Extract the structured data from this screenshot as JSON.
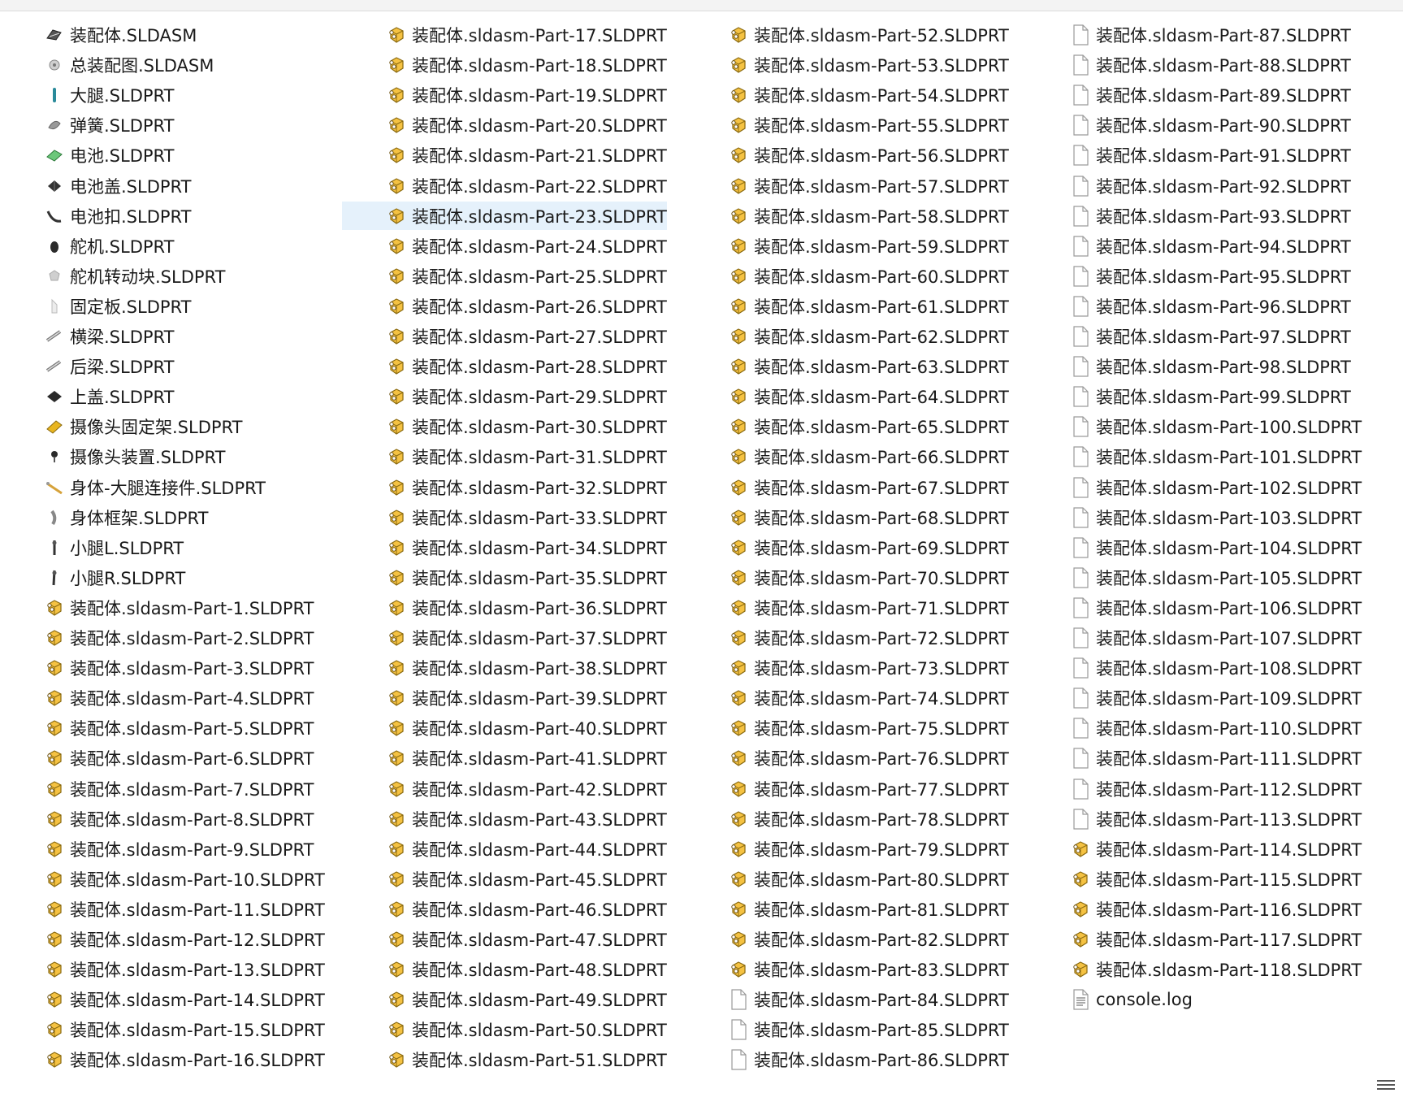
{
  "colors": {
    "selection": "#e5f1fb",
    "part_icon": "#f5c242",
    "blank_icon_border": "#9a9a9a"
  },
  "icons": {
    "part": "solidworks-part-icon",
    "blank": "blank-file-icon",
    "log": "text-file-icon",
    "model": "model-thumbnail-icon"
  },
  "selected_file": "装配体.sldasm-Part-23.SLDPRT",
  "columns": [
    {
      "items": [
        {
          "name": "装配体.SLDASM",
          "icon": "model"
        },
        {
          "name": "总装配图.SLDASM",
          "icon": "model"
        },
        {
          "name": "大腿.SLDPRT",
          "icon": "model"
        },
        {
          "name": "弹簧.SLDPRT",
          "icon": "model"
        },
        {
          "name": "电池.SLDPRT",
          "icon": "model"
        },
        {
          "name": "电池盖.SLDPRT",
          "icon": "model"
        },
        {
          "name": "电池扣.SLDPRT",
          "icon": "model"
        },
        {
          "name": "舵机.SLDPRT",
          "icon": "model"
        },
        {
          "name": "舵机转动块.SLDPRT",
          "icon": "model"
        },
        {
          "name": "固定板.SLDPRT",
          "icon": "model"
        },
        {
          "name": "横梁.SLDPRT",
          "icon": "model"
        },
        {
          "name": "后梁.SLDPRT",
          "icon": "model"
        },
        {
          "name": "上盖.SLDPRT",
          "icon": "model"
        },
        {
          "name": "摄像头固定架.SLDPRT",
          "icon": "model"
        },
        {
          "name": "摄像头装置.SLDPRT",
          "icon": "model"
        },
        {
          "name": "身体-大腿连接件.SLDPRT",
          "icon": "model"
        },
        {
          "name": "身体框架.SLDPRT",
          "icon": "model"
        },
        {
          "name": "小腿L.SLDPRT",
          "icon": "model"
        },
        {
          "name": "小腿R.SLDPRT",
          "icon": "model"
        },
        {
          "name": "装配体.sldasm-Part-1.SLDPRT",
          "icon": "part"
        },
        {
          "name": "装配体.sldasm-Part-2.SLDPRT",
          "icon": "part"
        },
        {
          "name": "装配体.sldasm-Part-3.SLDPRT",
          "icon": "part"
        },
        {
          "name": "装配体.sldasm-Part-4.SLDPRT",
          "icon": "part"
        },
        {
          "name": "装配体.sldasm-Part-5.SLDPRT",
          "icon": "part"
        },
        {
          "name": "装配体.sldasm-Part-6.SLDPRT",
          "icon": "part"
        },
        {
          "name": "装配体.sldasm-Part-7.SLDPRT",
          "icon": "part"
        },
        {
          "name": "装配体.sldasm-Part-8.SLDPRT",
          "icon": "part"
        },
        {
          "name": "装配体.sldasm-Part-9.SLDPRT",
          "icon": "part"
        },
        {
          "name": "装配体.sldasm-Part-10.SLDPRT",
          "icon": "part"
        },
        {
          "name": "装配体.sldasm-Part-11.SLDPRT",
          "icon": "part"
        },
        {
          "name": "装配体.sldasm-Part-12.SLDPRT",
          "icon": "part"
        },
        {
          "name": "装配体.sldasm-Part-13.SLDPRT",
          "icon": "part"
        },
        {
          "name": "装配体.sldasm-Part-14.SLDPRT",
          "icon": "part"
        },
        {
          "name": "装配体.sldasm-Part-15.SLDPRT",
          "icon": "part"
        },
        {
          "name": "装配体.sldasm-Part-16.SLDPRT",
          "icon": "part"
        }
      ]
    },
    {
      "items": [
        {
          "name": "装配体.sldasm-Part-17.SLDPRT",
          "icon": "part"
        },
        {
          "name": "装配体.sldasm-Part-18.SLDPRT",
          "icon": "part"
        },
        {
          "name": "装配体.sldasm-Part-19.SLDPRT",
          "icon": "part"
        },
        {
          "name": "装配体.sldasm-Part-20.SLDPRT",
          "icon": "part"
        },
        {
          "name": "装配体.sldasm-Part-21.SLDPRT",
          "icon": "part"
        },
        {
          "name": "装配体.sldasm-Part-22.SLDPRT",
          "icon": "part"
        },
        {
          "name": "装配体.sldasm-Part-23.SLDPRT",
          "icon": "part"
        },
        {
          "name": "装配体.sldasm-Part-24.SLDPRT",
          "icon": "part"
        },
        {
          "name": "装配体.sldasm-Part-25.SLDPRT",
          "icon": "part"
        },
        {
          "name": "装配体.sldasm-Part-26.SLDPRT",
          "icon": "part"
        },
        {
          "name": "装配体.sldasm-Part-27.SLDPRT",
          "icon": "part"
        },
        {
          "name": "装配体.sldasm-Part-28.SLDPRT",
          "icon": "part"
        },
        {
          "name": "装配体.sldasm-Part-29.SLDPRT",
          "icon": "part"
        },
        {
          "name": "装配体.sldasm-Part-30.SLDPRT",
          "icon": "part"
        },
        {
          "name": "装配体.sldasm-Part-31.SLDPRT",
          "icon": "part"
        },
        {
          "name": "装配体.sldasm-Part-32.SLDPRT",
          "icon": "part"
        },
        {
          "name": "装配体.sldasm-Part-33.SLDPRT",
          "icon": "part"
        },
        {
          "name": "装配体.sldasm-Part-34.SLDPRT",
          "icon": "part"
        },
        {
          "name": "装配体.sldasm-Part-35.SLDPRT",
          "icon": "part"
        },
        {
          "name": "装配体.sldasm-Part-36.SLDPRT",
          "icon": "part"
        },
        {
          "name": "装配体.sldasm-Part-37.SLDPRT",
          "icon": "part"
        },
        {
          "name": "装配体.sldasm-Part-38.SLDPRT",
          "icon": "part"
        },
        {
          "name": "装配体.sldasm-Part-39.SLDPRT",
          "icon": "part"
        },
        {
          "name": "装配体.sldasm-Part-40.SLDPRT",
          "icon": "part"
        },
        {
          "name": "装配体.sldasm-Part-41.SLDPRT",
          "icon": "part"
        },
        {
          "name": "装配体.sldasm-Part-42.SLDPRT",
          "icon": "part"
        },
        {
          "name": "装配体.sldasm-Part-43.SLDPRT",
          "icon": "part"
        },
        {
          "name": "装配体.sldasm-Part-44.SLDPRT",
          "icon": "part"
        },
        {
          "name": "装配体.sldasm-Part-45.SLDPRT",
          "icon": "part"
        },
        {
          "name": "装配体.sldasm-Part-46.SLDPRT",
          "icon": "part"
        },
        {
          "name": "装配体.sldasm-Part-47.SLDPRT",
          "icon": "part"
        },
        {
          "name": "装配体.sldasm-Part-48.SLDPRT",
          "icon": "part"
        },
        {
          "name": "装配体.sldasm-Part-49.SLDPRT",
          "icon": "part"
        },
        {
          "name": "装配体.sldasm-Part-50.SLDPRT",
          "icon": "part"
        },
        {
          "name": "装配体.sldasm-Part-51.SLDPRT",
          "icon": "part"
        }
      ]
    },
    {
      "items": [
        {
          "name": "装配体.sldasm-Part-52.SLDPRT",
          "icon": "part"
        },
        {
          "name": "装配体.sldasm-Part-53.SLDPRT",
          "icon": "part"
        },
        {
          "name": "装配体.sldasm-Part-54.SLDPRT",
          "icon": "part"
        },
        {
          "name": "装配体.sldasm-Part-55.SLDPRT",
          "icon": "part"
        },
        {
          "name": "装配体.sldasm-Part-56.SLDPRT",
          "icon": "part"
        },
        {
          "name": "装配体.sldasm-Part-57.SLDPRT",
          "icon": "part"
        },
        {
          "name": "装配体.sldasm-Part-58.SLDPRT",
          "icon": "part"
        },
        {
          "name": "装配体.sldasm-Part-59.SLDPRT",
          "icon": "part"
        },
        {
          "name": "装配体.sldasm-Part-60.SLDPRT",
          "icon": "part"
        },
        {
          "name": "装配体.sldasm-Part-61.SLDPRT",
          "icon": "part"
        },
        {
          "name": "装配体.sldasm-Part-62.SLDPRT",
          "icon": "part"
        },
        {
          "name": "装配体.sldasm-Part-63.SLDPRT",
          "icon": "part"
        },
        {
          "name": "装配体.sldasm-Part-64.SLDPRT",
          "icon": "part"
        },
        {
          "name": "装配体.sldasm-Part-65.SLDPRT",
          "icon": "part"
        },
        {
          "name": "装配体.sldasm-Part-66.SLDPRT",
          "icon": "part"
        },
        {
          "name": "装配体.sldasm-Part-67.SLDPRT",
          "icon": "part"
        },
        {
          "name": "装配体.sldasm-Part-68.SLDPRT",
          "icon": "part"
        },
        {
          "name": "装配体.sldasm-Part-69.SLDPRT",
          "icon": "part"
        },
        {
          "name": "装配体.sldasm-Part-70.SLDPRT",
          "icon": "part"
        },
        {
          "name": "装配体.sldasm-Part-71.SLDPRT",
          "icon": "part"
        },
        {
          "name": "装配体.sldasm-Part-72.SLDPRT",
          "icon": "part"
        },
        {
          "name": "装配体.sldasm-Part-73.SLDPRT",
          "icon": "part"
        },
        {
          "name": "装配体.sldasm-Part-74.SLDPRT",
          "icon": "part"
        },
        {
          "name": "装配体.sldasm-Part-75.SLDPRT",
          "icon": "part"
        },
        {
          "name": "装配体.sldasm-Part-76.SLDPRT",
          "icon": "part"
        },
        {
          "name": "装配体.sldasm-Part-77.SLDPRT",
          "icon": "part"
        },
        {
          "name": "装配体.sldasm-Part-78.SLDPRT",
          "icon": "part"
        },
        {
          "name": "装配体.sldasm-Part-79.SLDPRT",
          "icon": "part"
        },
        {
          "name": "装配体.sldasm-Part-80.SLDPRT",
          "icon": "part"
        },
        {
          "name": "装配体.sldasm-Part-81.SLDPRT",
          "icon": "part"
        },
        {
          "name": "装配体.sldasm-Part-82.SLDPRT",
          "icon": "part"
        },
        {
          "name": "装配体.sldasm-Part-83.SLDPRT",
          "icon": "part"
        },
        {
          "name": "装配体.sldasm-Part-84.SLDPRT",
          "icon": "blank"
        },
        {
          "name": "装配体.sldasm-Part-85.SLDPRT",
          "icon": "blank"
        },
        {
          "name": "装配体.sldasm-Part-86.SLDPRT",
          "icon": "blank"
        }
      ]
    },
    {
      "items": [
        {
          "name": "装配体.sldasm-Part-87.SLDPRT",
          "icon": "blank"
        },
        {
          "name": "装配体.sldasm-Part-88.SLDPRT",
          "icon": "blank"
        },
        {
          "name": "装配体.sldasm-Part-89.SLDPRT",
          "icon": "blank"
        },
        {
          "name": "装配体.sldasm-Part-90.SLDPRT",
          "icon": "blank"
        },
        {
          "name": "装配体.sldasm-Part-91.SLDPRT",
          "icon": "blank"
        },
        {
          "name": "装配体.sldasm-Part-92.SLDPRT",
          "icon": "blank"
        },
        {
          "name": "装配体.sldasm-Part-93.SLDPRT",
          "icon": "blank"
        },
        {
          "name": "装配体.sldasm-Part-94.SLDPRT",
          "icon": "blank"
        },
        {
          "name": "装配体.sldasm-Part-95.SLDPRT",
          "icon": "blank"
        },
        {
          "name": "装配体.sldasm-Part-96.SLDPRT",
          "icon": "blank"
        },
        {
          "name": "装配体.sldasm-Part-97.SLDPRT",
          "icon": "blank"
        },
        {
          "name": "装配体.sldasm-Part-98.SLDPRT",
          "icon": "blank"
        },
        {
          "name": "装配体.sldasm-Part-99.SLDPRT",
          "icon": "blank"
        },
        {
          "name": "装配体.sldasm-Part-100.SLDPRT",
          "icon": "blank"
        },
        {
          "name": "装配体.sldasm-Part-101.SLDPRT",
          "icon": "blank"
        },
        {
          "name": "装配体.sldasm-Part-102.SLDPRT",
          "icon": "blank"
        },
        {
          "name": "装配体.sldasm-Part-103.SLDPRT",
          "icon": "blank"
        },
        {
          "name": "装配体.sldasm-Part-104.SLDPRT",
          "icon": "blank"
        },
        {
          "name": "装配体.sldasm-Part-105.SLDPRT",
          "icon": "blank"
        },
        {
          "name": "装配体.sldasm-Part-106.SLDPRT",
          "icon": "blank"
        },
        {
          "name": "装配体.sldasm-Part-107.SLDPRT",
          "icon": "blank"
        },
        {
          "name": "装配体.sldasm-Part-108.SLDPRT",
          "icon": "blank"
        },
        {
          "name": "装配体.sldasm-Part-109.SLDPRT",
          "icon": "blank"
        },
        {
          "name": "装配体.sldasm-Part-110.SLDPRT",
          "icon": "blank"
        },
        {
          "name": "装配体.sldasm-Part-111.SLDPRT",
          "icon": "blank"
        },
        {
          "name": "装配体.sldasm-Part-112.SLDPRT",
          "icon": "blank"
        },
        {
          "name": "装配体.sldasm-Part-113.SLDPRT",
          "icon": "blank"
        },
        {
          "name": "装配体.sldasm-Part-114.SLDPRT",
          "icon": "part"
        },
        {
          "name": "装配体.sldasm-Part-115.SLDPRT",
          "icon": "part"
        },
        {
          "name": "装配体.sldasm-Part-116.SLDPRT",
          "icon": "part"
        },
        {
          "name": "装配体.sldasm-Part-117.SLDPRT",
          "icon": "part"
        },
        {
          "name": "装配体.sldasm-Part-118.SLDPRT",
          "icon": "part"
        },
        {
          "name": "console.log",
          "icon": "log"
        }
      ]
    }
  ]
}
